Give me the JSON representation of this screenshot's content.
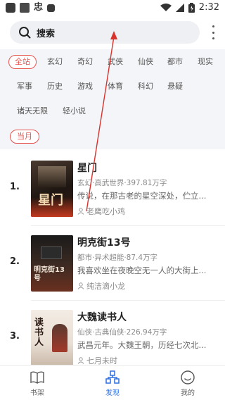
{
  "status_bar": {
    "time": "2:32"
  },
  "search": {
    "label": "搜索"
  },
  "categories": [
    {
      "label": "全站",
      "active": true
    },
    {
      "label": "玄幻"
    },
    {
      "label": "奇幻"
    },
    {
      "label": "武侠"
    },
    {
      "label": "仙侠"
    },
    {
      "label": "都市"
    },
    {
      "label": "现实"
    },
    {
      "label": "军事"
    },
    {
      "label": "历史"
    },
    {
      "label": "游戏"
    },
    {
      "label": "体育"
    },
    {
      "label": "科幻"
    },
    {
      "label": "悬疑"
    },
    {
      "label": "诸天无限"
    },
    {
      "label": "轻小说"
    }
  ],
  "rank_tab": {
    "label": "当月"
  },
  "books": [
    {
      "rank": "1.",
      "title": "星门",
      "meta": "玄幻·高武世界·397.81万字",
      "desc": "传说，在那古老的星空深处，伫立...",
      "author": "老鹰吃小鸡",
      "cover_text": "星门"
    },
    {
      "rank": "2.",
      "title": "明克街13号",
      "meta": "都市·异术超能·87.4万字",
      "desc": "我喜欢坐在夜晚空无一人的大街上...",
      "author": "纯洁滴小龙",
      "cover_text": "明克街13号"
    },
    {
      "rank": "3.",
      "title": "大魏读书人",
      "meta": "仙侠·古典仙侠·226.94万字",
      "desc": "武昌元年。大魏王朝，历经七次北...",
      "author": "七月未时",
      "cover_text": "读书人"
    }
  ],
  "bottom_nav": [
    {
      "label": "书架",
      "icon": "book-icon",
      "active": false
    },
    {
      "label": "发现",
      "icon": "discover-icon",
      "active": true
    },
    {
      "label": "我的",
      "icon": "smile-icon",
      "active": false
    }
  ],
  "colors": {
    "accent": "#e5544f",
    "nav_active": "#2f6fe0",
    "panel_bg": "#f4f5f8"
  }
}
